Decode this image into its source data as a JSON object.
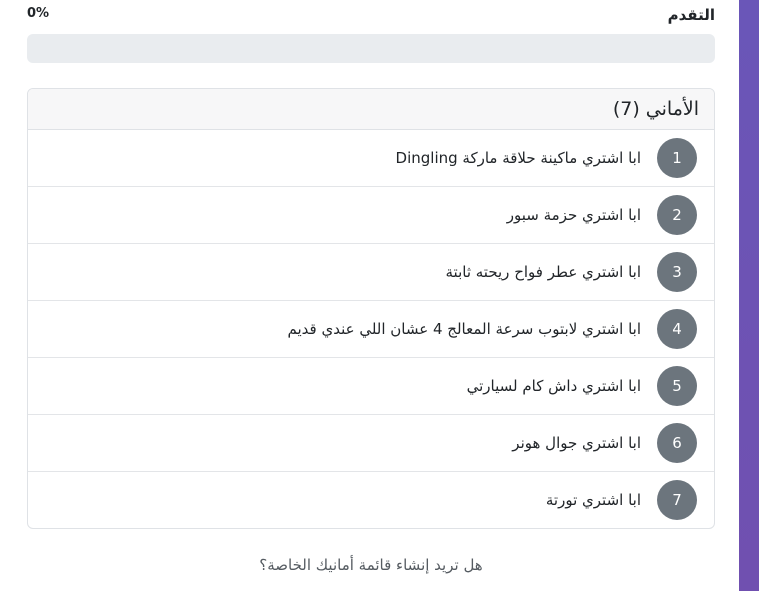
{
  "progress": {
    "title": "التقدم",
    "percent_label": "0%",
    "value": 0
  },
  "wishlist": {
    "title": "الأماني (7)",
    "items": [
      {
        "number": "1",
        "text": "ابا اشتري ماكينة حلاقة ماركة Dingling"
      },
      {
        "number": "2",
        "text": "ابا اشتري حزمة سبور"
      },
      {
        "number": "3",
        "text": "ابا اشتري عطر فواح ريحته ثابتة"
      },
      {
        "number": "4",
        "text": "ابا اشتري لابتوب سرعة المعالج 4 عشان اللي عندي قديم"
      },
      {
        "number": "5",
        "text": "ابا اشتري داش كام لسيارتي"
      },
      {
        "number": "6",
        "text": "ابا اشتري جوال هونر"
      },
      {
        "number": "7",
        "text": "ابا اشتري تورتة"
      }
    ]
  },
  "cta": {
    "text": "هل تريد إنشاء قائمة أمانيك الخاصة؟"
  },
  "colors": {
    "accent": "#6a56b8",
    "badge": "#6c757d"
  }
}
